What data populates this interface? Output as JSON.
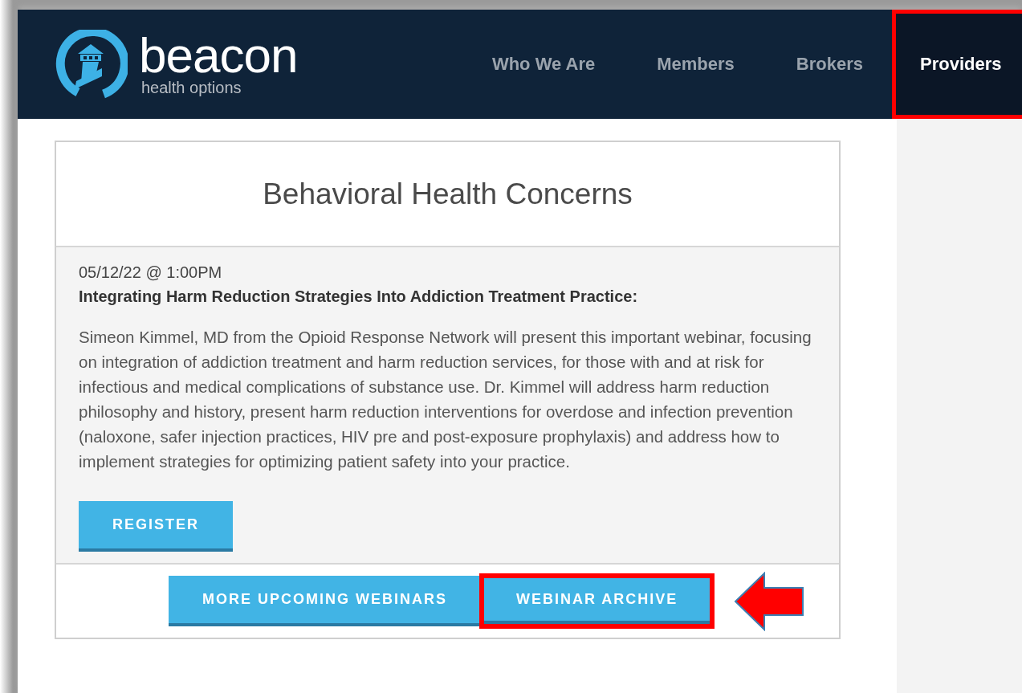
{
  "logo": {
    "name": "beacon",
    "tagline": "health options"
  },
  "nav": [
    {
      "label": "Who We Are",
      "selected": false,
      "highlighted": false
    },
    {
      "label": "Members",
      "selected": false,
      "highlighted": false
    },
    {
      "label": "Brokers",
      "selected": false,
      "highlighted": false
    },
    {
      "label": "Providers",
      "selected": true,
      "highlighted": true
    }
  ],
  "card": {
    "title": "Behavioral Health Concerns",
    "date": "05/12/22 @ 1:00PM",
    "heading": "Integrating Harm Reduction Strategies Into Addiction Treatment Practice:",
    "description": "Simeon Kimmel, MD from the Opioid Response Network will present this important webinar, focusing on integration of addiction treatment and harm reduction services, for those with and at risk for infectious and medical complications of substance use. Dr. Kimmel will address harm reduction philosophy and history, present harm reduction interventions for overdose and infection prevention (naloxone, safer injection practices, HIV pre and post-exposure prophylaxis) and address how to implement strategies for optimizing patient safety into your practice.",
    "register_button": "REGISTER",
    "footer_buttons": [
      {
        "label": "MORE UPCOMING WEBINARS",
        "highlighted": false
      },
      {
        "label": "WEBINAR ARCHIVE",
        "highlighted": true
      }
    ]
  }
}
